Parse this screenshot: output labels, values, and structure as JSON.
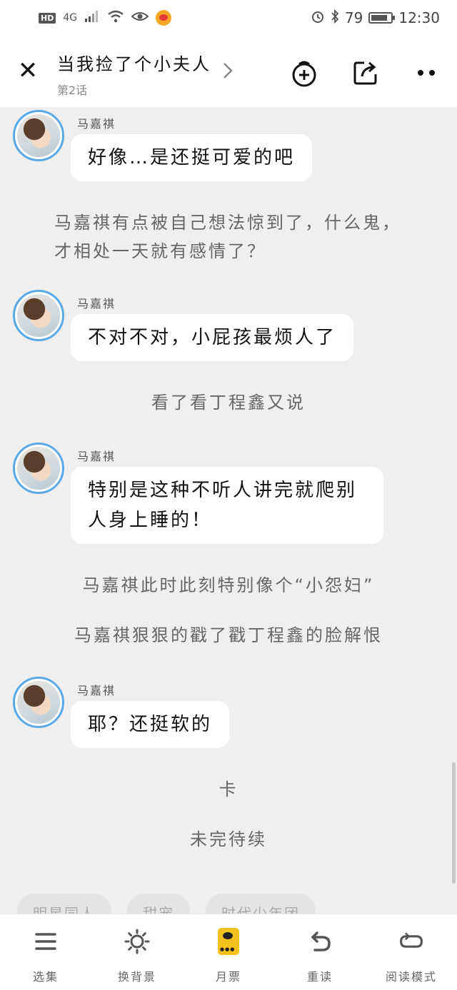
{
  "status_bar": {
    "hd": "HD",
    "signal": "4G",
    "battery": "79",
    "time": "12:30"
  },
  "header": {
    "title": "当我捡了个小夫人",
    "chapter": "第2话"
  },
  "messages": [
    {
      "sender": "马嘉祺",
      "text": "好像…是还挺可爱的吧"
    },
    {
      "sender": "马嘉祺",
      "text": "不对不对，小屁孩最烦人了"
    },
    {
      "sender": "马嘉祺",
      "text_line1": "特别是这种不听人讲完就爬别",
      "text_line2": "人身上睡的！"
    },
    {
      "sender": "马嘉祺",
      "text": "耶？还挺软的"
    }
  ],
  "narrations": {
    "n1_line1": "马嘉祺有点被自己想法惊到了，什么鬼，",
    "n1_line2": "才相处一天就有感情了？",
    "n2": "看了看丁程鑫又说",
    "n3": "马嘉祺此时此刻特别像个“小怨妇”",
    "n4": "马嘉祺狠狠的戳了戳丁程鑫的脸解恨",
    "n5": "卡",
    "n6": "未完待续"
  },
  "tags": [
    "明星同人",
    "甜宠",
    "时代少年团"
  ],
  "bottom_bar": {
    "catalog": "选集",
    "background": "换背景",
    "monthly_ticket": "月票",
    "reread": "重读",
    "read_mode": "阅读模式"
  },
  "icons": {
    "close": "close-icon",
    "chevron": "chevron-right-icon",
    "favorite": "bookmark-add-icon",
    "share": "share-icon",
    "more": "more-icon"
  },
  "colors": {
    "avatar_ring": "#5aa9e6",
    "ticket": "#f4c21d",
    "background": "#efefef"
  }
}
